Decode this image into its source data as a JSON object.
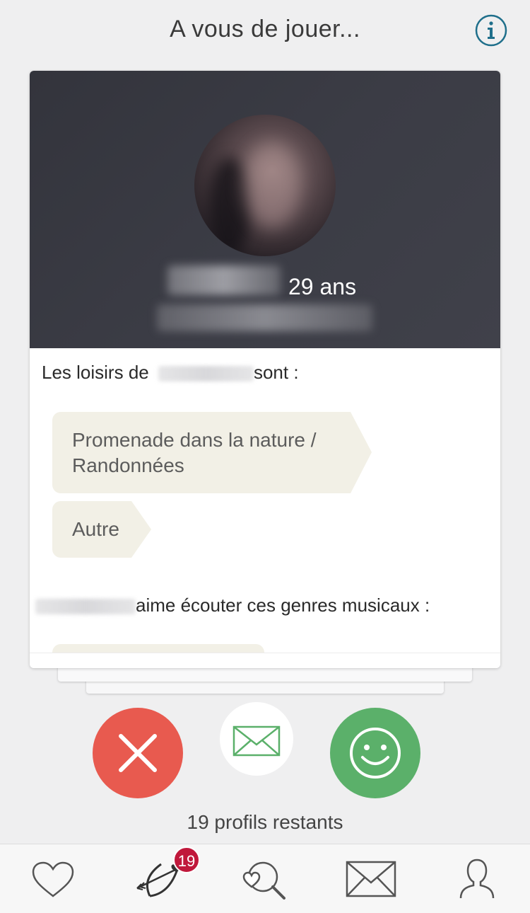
{
  "header": {
    "title": "A vous de jouer...",
    "info_icon": "info-circle-icon"
  },
  "card": {
    "age": "29 ans",
    "hobbies_prefix": "Les loisirs de",
    "hobbies_suffix": "sont :",
    "hobbies": [
      "Promenade dans la nature / Randonnées",
      "Autre"
    ],
    "music_suffix": "aime écouter ces genres musicaux :"
  },
  "actions": {
    "reject_icon": "close-icon",
    "message_icon": "envelope-icon",
    "like_icon": "smiley-icon"
  },
  "remaining_text": "19 profils restants",
  "tabbar": {
    "items": [
      {
        "icon": "heart-icon"
      },
      {
        "icon": "cupid-bow-icon",
        "badge": "19"
      },
      {
        "icon": "search-heart-icon"
      },
      {
        "icon": "envelope-icon"
      },
      {
        "icon": "profile-icon"
      }
    ]
  },
  "colors": {
    "reject": "#e85a4f",
    "like": "#5bb06a",
    "info": "#1f6f8b",
    "badge": "#c0183b",
    "tag_bg": "#f2f0e6"
  }
}
